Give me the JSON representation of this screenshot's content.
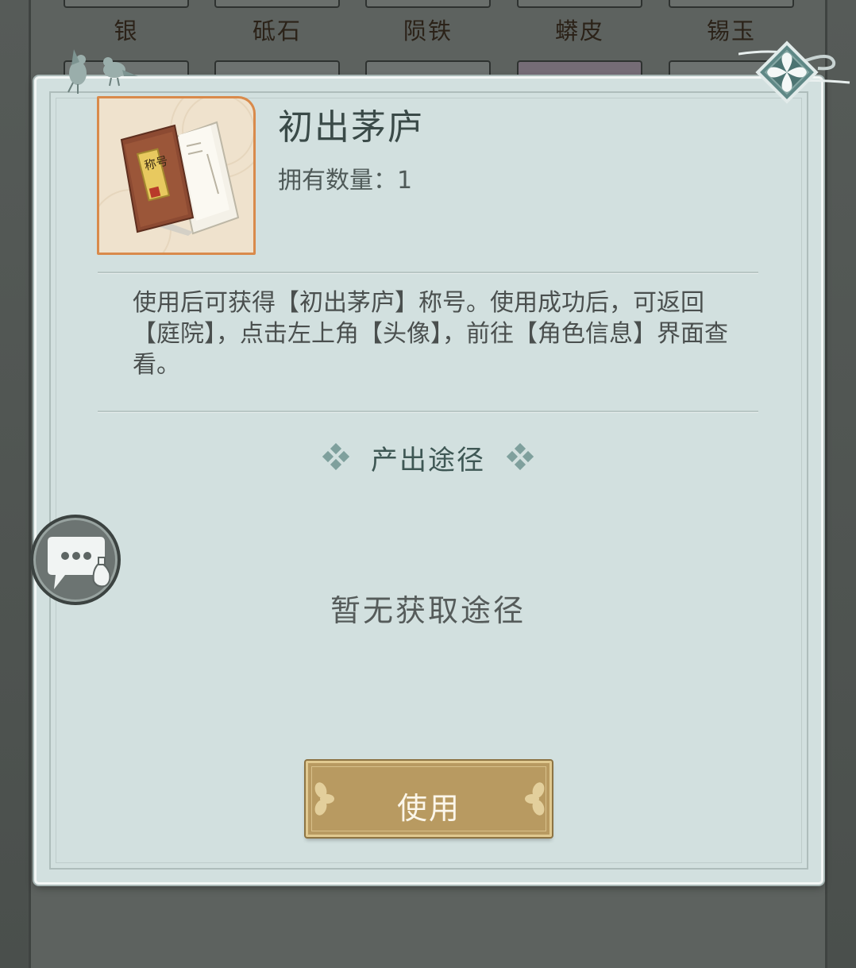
{
  "inventory": {
    "items": [
      {
        "label": "银"
      },
      {
        "label": "砥石"
      },
      {
        "label": "陨铁"
      },
      {
        "label": "蟒皮"
      },
      {
        "label": "锡玉"
      }
    ]
  },
  "item": {
    "title": "初出茅庐",
    "count_label": "拥有数量：",
    "count_value": "1",
    "icon_text": "称号",
    "description": "使用后可获得【初出茅庐】称号。使用成功后，可返回【庭院】，点击左上角【头像】，前往【角色信息】界面查看。"
  },
  "source": {
    "title": "产出途径",
    "empty_text": "暂无获取途径"
  },
  "actions": {
    "use_label": "使用"
  },
  "colors": {
    "panel": "#d2e0df",
    "button": "#b89a61",
    "icon_border": "#d98a4b"
  }
}
